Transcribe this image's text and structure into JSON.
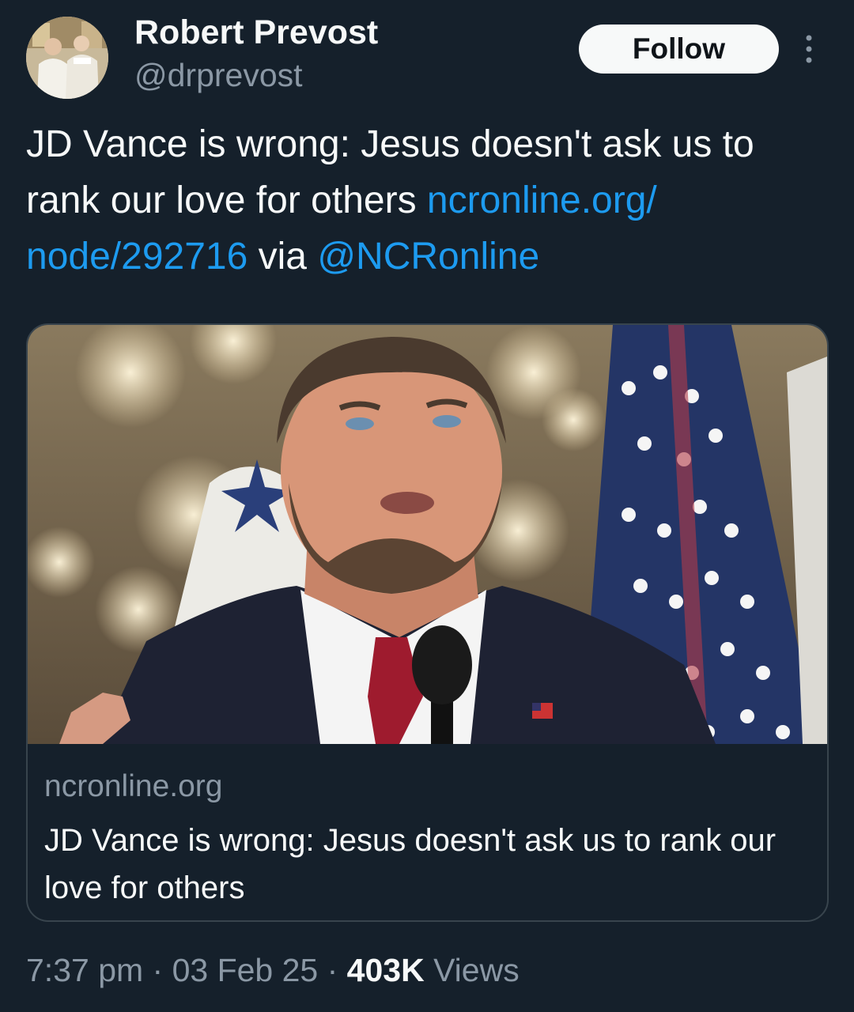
{
  "author": {
    "display_name": "Robert Prevost",
    "handle": "@drprevost",
    "avatar_icon": "profile-photo"
  },
  "actions": {
    "follow_label": "Follow",
    "more_icon": "vertical-ellipsis-icon"
  },
  "tweet": {
    "text_part1": "JD Vance is wrong: Jesus doesn't ask us to rank our love for others ",
    "link_url": "ncronline.org/​node/292716",
    "text_part2": " via ",
    "mention": "@NCRonline"
  },
  "card": {
    "domain": "ncronline.org",
    "title": "JD Vance is wrong: Jesus doesn't ask us to rank our love for others"
  },
  "meta": {
    "time": "7:37 pm",
    "sep1": " · ",
    "date": "03 Feb 25",
    "sep2": " · ",
    "views_count": "403K",
    "views_label": " Views"
  },
  "colors": {
    "background": "#15202b",
    "link": "#1d9bf0",
    "secondary_text": "#8b98a5",
    "border": "#38444d"
  }
}
